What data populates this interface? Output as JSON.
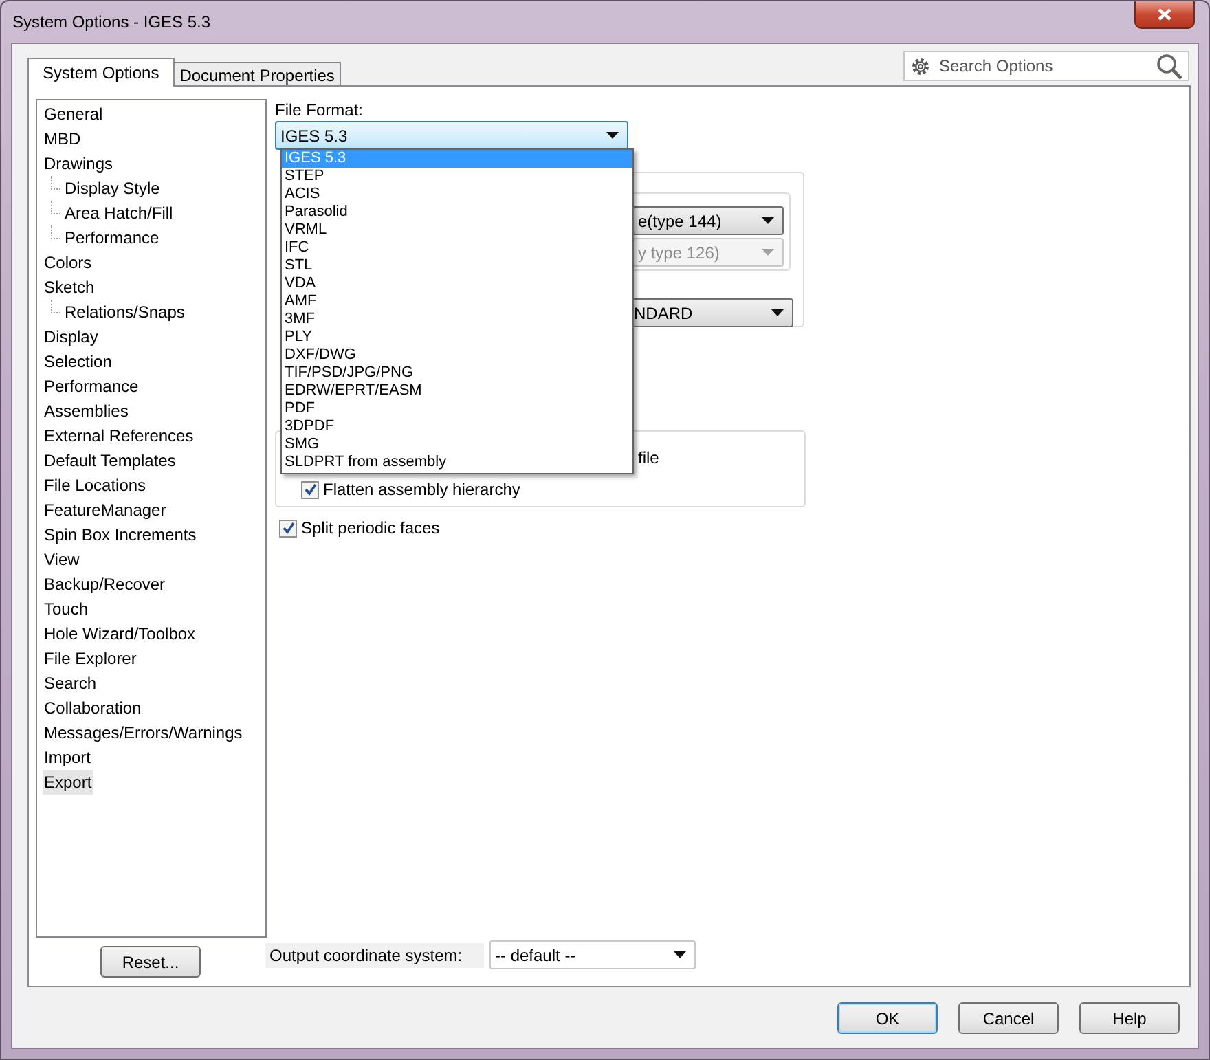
{
  "window": {
    "title": "System Options - IGES 5.3"
  },
  "tabs": [
    {
      "label": "System Options",
      "selected": true
    },
    {
      "label": "Document Properties",
      "selected": false
    }
  ],
  "search": {
    "placeholder": "Search Options"
  },
  "sidebar": {
    "items": [
      {
        "label": "General",
        "selected": false
      },
      {
        "label": "MBD",
        "selected": false
      },
      {
        "label": "Drawings",
        "selected": false,
        "children": [
          {
            "label": "Display Style",
            "selected": false
          },
          {
            "label": "Area Hatch/Fill",
            "selected": false
          },
          {
            "label": "Performance",
            "selected": false
          }
        ]
      },
      {
        "label": "Colors",
        "selected": false
      },
      {
        "label": "Sketch",
        "selected": false,
        "children": [
          {
            "label": "Relations/Snaps",
            "selected": false
          }
        ]
      },
      {
        "label": "Display",
        "selected": false
      },
      {
        "label": "Selection",
        "selected": false
      },
      {
        "label": "Performance",
        "selected": false
      },
      {
        "label": "Assemblies",
        "selected": false
      },
      {
        "label": "External References",
        "selected": false
      },
      {
        "label": "Default Templates",
        "selected": false
      },
      {
        "label": "File Locations",
        "selected": false
      },
      {
        "label": "FeatureManager",
        "selected": false
      },
      {
        "label": "Spin Box Increments",
        "selected": false
      },
      {
        "label": "View",
        "selected": false
      },
      {
        "label": "Backup/Recover",
        "selected": false
      },
      {
        "label": "Touch",
        "selected": false
      },
      {
        "label": "Hole Wizard/Toolbox",
        "selected": false
      },
      {
        "label": "File Explorer",
        "selected": false
      },
      {
        "label": "Search",
        "selected": false
      },
      {
        "label": "Collaboration",
        "selected": false
      },
      {
        "label": "Messages/Errors/Warnings",
        "selected": false
      },
      {
        "label": "Import",
        "selected": false
      },
      {
        "label": "Export",
        "selected": true
      }
    ],
    "reset_button": "Reset..."
  },
  "file_format": {
    "label": "File Format:",
    "value": "IGES 5.3",
    "expanded": true,
    "options": [
      {
        "label": "IGES 5.3",
        "selected": true
      },
      {
        "label": "STEP",
        "selected": false
      },
      {
        "label": "ACIS",
        "selected": false
      },
      {
        "label": "Parasolid",
        "selected": false
      },
      {
        "label": "VRML",
        "selected": false
      },
      {
        "label": "IFC",
        "selected": false
      },
      {
        "label": "STL",
        "selected": false
      },
      {
        "label": "VDA",
        "selected": false
      },
      {
        "label": "AMF",
        "selected": false
      },
      {
        "label": "3MF",
        "selected": false
      },
      {
        "label": "PLY",
        "selected": false
      },
      {
        "label": "DXF/DWG",
        "selected": false
      },
      {
        "label": "TIF/PSD/JPG/PNG",
        "selected": false
      },
      {
        "label": "EDRW/EPRT/EASM",
        "selected": false
      },
      {
        "label": "PDF",
        "selected": false
      },
      {
        "label": "3DPDF",
        "selected": false
      },
      {
        "label": "SMG",
        "selected": false
      },
      {
        "label": "SLDPRT from assembly",
        "selected": false
      }
    ]
  },
  "surface_group": {
    "combos": [
      {
        "text": "e(type 144)",
        "disabled": false
      },
      {
        "text": "y type 126)",
        "disabled": true
      },
      {
        "text": "NDARD",
        "disabled": false
      }
    ]
  },
  "assembly_group": {
    "text": "file",
    "checkboxes": [
      {
        "label": "Flatten assembly hierarchy",
        "checked": true
      }
    ]
  },
  "checkboxes": [
    {
      "label": "Split periodic faces",
      "checked": true
    }
  ],
  "output_coordinate_system": {
    "label": "Output coordinate system:",
    "value": "-- default --"
  },
  "buttons": [
    {
      "label": "OK",
      "default": true
    },
    {
      "label": "Cancel",
      "default": false
    },
    {
      "label": "Help",
      "default": false
    }
  ]
}
